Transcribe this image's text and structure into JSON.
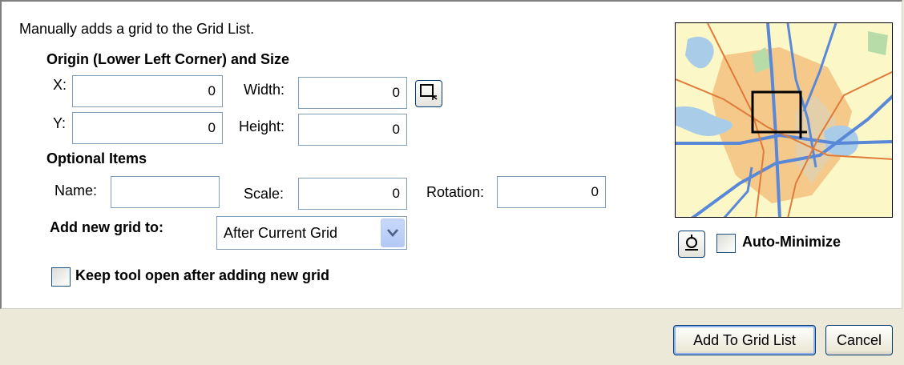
{
  "description": "Manually adds a grid to the Grid List.",
  "origin_section": {
    "title": "Origin (Lower Left Corner) and Size",
    "x_label": "X:",
    "x_value": "0",
    "y_label": "Y:",
    "y_value": "0",
    "width_label": "Width:",
    "width_value": "0",
    "height_label": "Height:",
    "height_value": "0"
  },
  "optional_section": {
    "title": "Optional Items",
    "name_label": "Name:",
    "name_value": "",
    "scale_label": "Scale:",
    "scale_value": "0",
    "rotation_label": "Rotation:",
    "rotation_value": "0"
  },
  "add_to": {
    "label": "Add new grid to:",
    "selected": "After Current Grid"
  },
  "keep_open": {
    "label": "Keep tool open after adding new grid",
    "checked": false
  },
  "auto_minimize": {
    "label": "Auto-Minimize",
    "checked": false
  },
  "buttons": {
    "add": "Add To Grid List",
    "cancel": "Cancel"
  },
  "icons": {
    "draw_extent": "draw-rectangle-icon",
    "locate": "magnifier-locate-icon",
    "dropdown": "chevron-down-icon"
  },
  "colors": {
    "window_bg": "#ece9d8",
    "panel_bg": "#ffffff",
    "field_border": "#7f9db9",
    "map_road_blue": "#5a88d8",
    "map_urban": "#f5c98a"
  }
}
